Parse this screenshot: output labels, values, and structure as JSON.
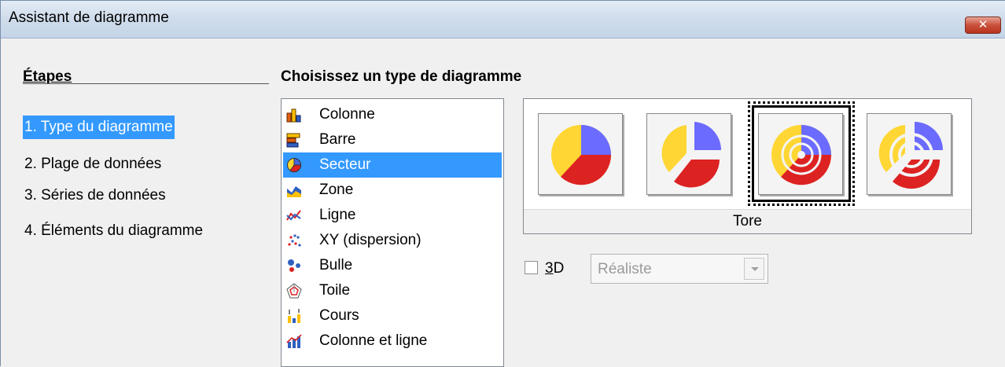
{
  "window": {
    "title": "Assistant de diagramme",
    "close_glyph": "✕"
  },
  "steps": {
    "heading": "Étapes",
    "items": [
      {
        "label": "1. Type du diagramme",
        "active": true
      },
      {
        "label": "2. Plage de données"
      },
      {
        "label": "3. Séries de données"
      },
      {
        "label": "4. Éléments du diagramme"
      }
    ]
  },
  "chart_type": {
    "heading": "Choisissez un type de diagramme",
    "list": [
      {
        "label": "Colonne",
        "icon": "column-chart-icon"
      },
      {
        "label": "Barre",
        "icon": "bar-chart-icon"
      },
      {
        "label": "Secteur",
        "icon": "pie-chart-icon",
        "selected": true
      },
      {
        "label": "Zone",
        "icon": "area-chart-icon"
      },
      {
        "label": "Ligne",
        "icon": "line-chart-icon"
      },
      {
        "label": "XY (dispersion)",
        "icon": "scatter-chart-icon"
      },
      {
        "label": "Bulle",
        "icon": "bubble-chart-icon"
      },
      {
        "label": "Toile",
        "icon": "net-chart-icon"
      },
      {
        "label": "Cours",
        "icon": "stock-chart-icon"
      },
      {
        "label": "Colonne et ligne",
        "icon": "column-line-chart-icon"
      }
    ],
    "variants": [
      {
        "name": "normal",
        "icon": "pie-normal-icon"
      },
      {
        "name": "exploded",
        "icon": "pie-exploded-icon"
      },
      {
        "name": "donut",
        "icon": "donut-icon",
        "selected": true
      },
      {
        "name": "exploded-donut",
        "icon": "donut-exploded-icon"
      }
    ],
    "selected_variant_caption": "Tore",
    "three_d": {
      "label_prefix": "",
      "mnemonic": "3",
      "label_rest": "D",
      "checked": false
    },
    "look": {
      "value": "Réaliste",
      "enabled": false
    }
  },
  "colors": {
    "selection": "#3399ff",
    "pie_yellow": "#ffd633",
    "pie_blue": "#6b6bff",
    "pie_red": "#dd2222"
  }
}
